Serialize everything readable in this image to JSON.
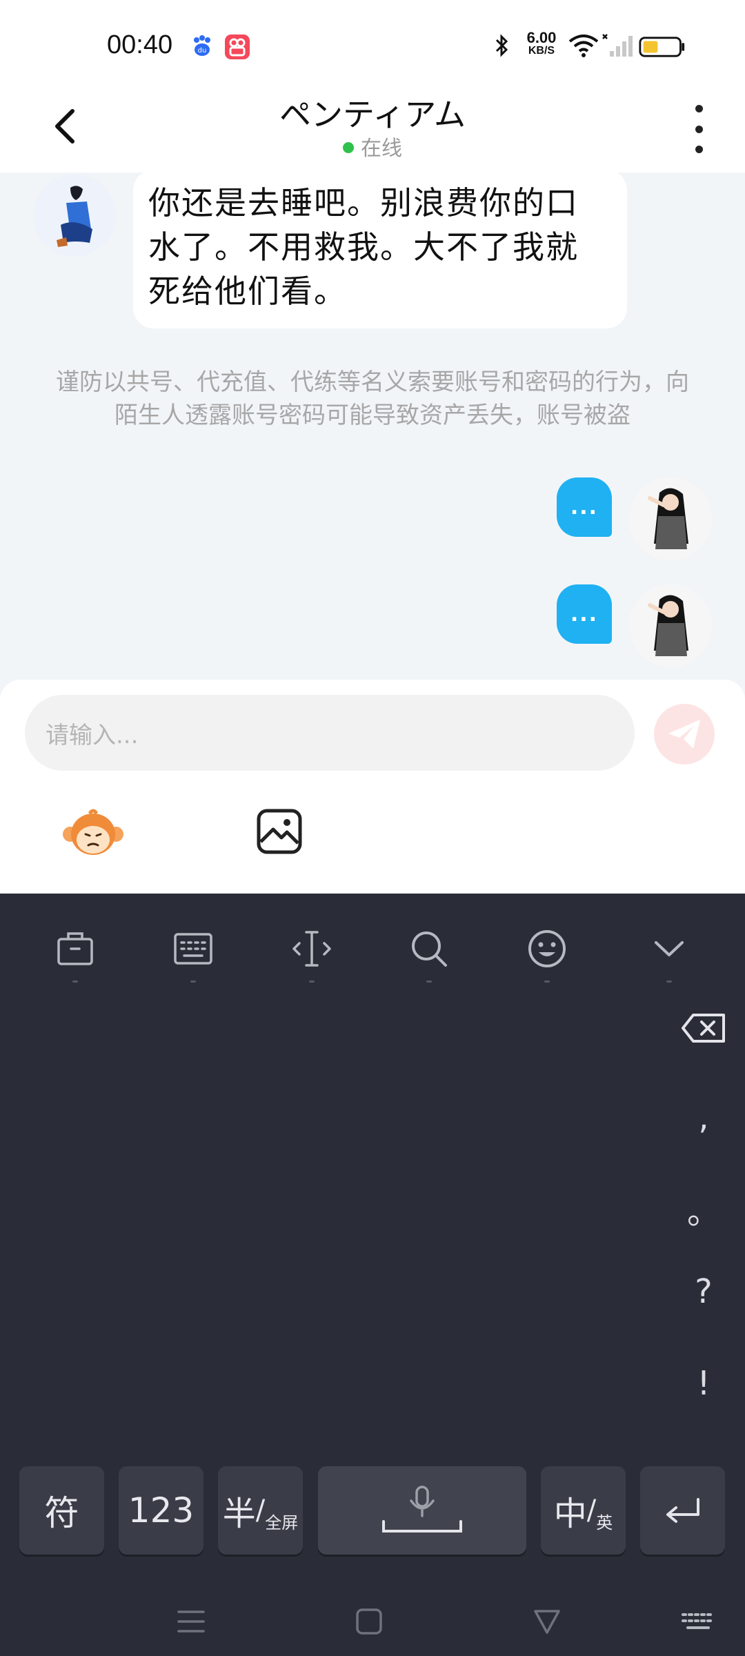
{
  "status_bar": {
    "time": "00:40",
    "net_speed_value": "6.00",
    "net_speed_unit": "KB/S",
    "icons": [
      "baidu-app-icon",
      "kuaishou-app-icon",
      "bluetooth-icon",
      "wifi-icon",
      "signal-icon",
      "battery-icon"
    ],
    "battery_color": "#f4c430"
  },
  "header": {
    "title": "ペンティアム",
    "status": "在线",
    "status_color": "#2ec24c"
  },
  "messages": [
    {
      "side": "left",
      "text": "你还是去睡吧。别浪费你的口水了。不用救我。大不了我就死给他们看。"
    },
    {
      "side": "right",
      "text": "..."
    },
    {
      "side": "right",
      "text": "..."
    }
  ],
  "notice": "谨防以共号、代充值、代练等名义索要账号和密码的行为，向陌生人透露账号密码可能导致资产丢失，账号被盗",
  "input": {
    "placeholder": "请输入..."
  },
  "keyboard": {
    "toolbar": [
      "clipboard-icon",
      "keyboard-layout-icon",
      "cursor-icon",
      "search-icon",
      "emoji-icon",
      "collapse-icon"
    ],
    "side_keys": [
      ",",
      "。",
      "?",
      "!"
    ],
    "bottom_row": {
      "symbols": "符",
      "numbers": "123",
      "half_big": "半",
      "half_small": "全屏",
      "lang_big": "中",
      "lang_small": "英"
    },
    "accent_color": "#2a2c37"
  },
  "colors": {
    "bubble_self": "#1fb1f2",
    "send_button": "#fde4e4"
  }
}
